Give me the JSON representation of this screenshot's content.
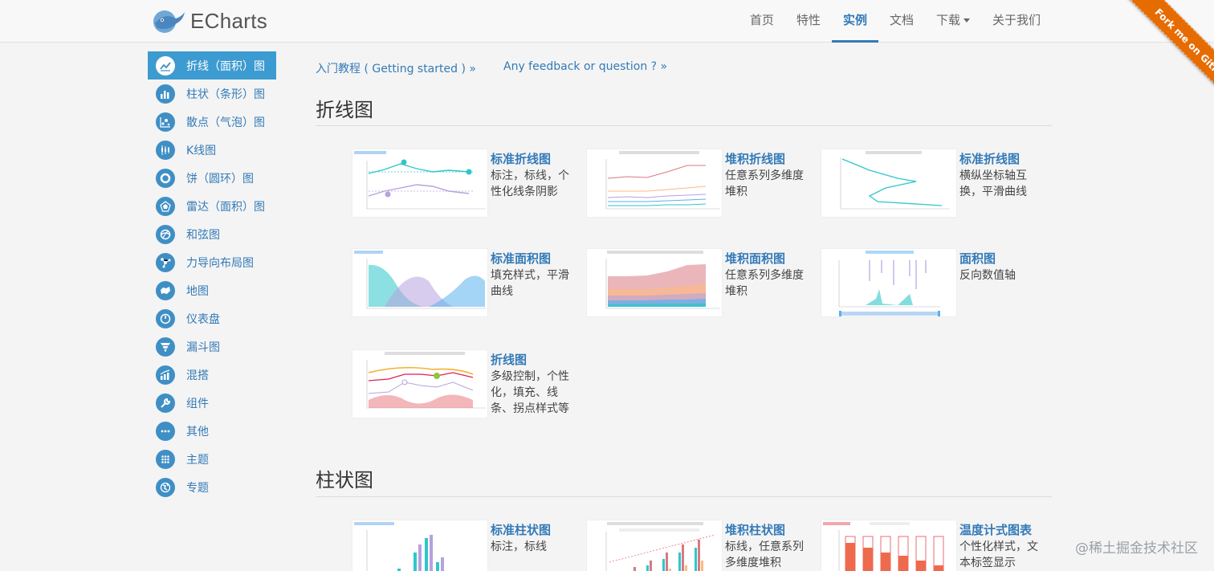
{
  "header": {
    "brand": "ECharts",
    "nav": [
      {
        "label": "首页"
      },
      {
        "label": "特性"
      },
      {
        "label": "实例"
      },
      {
        "label": "文档"
      },
      {
        "label": "下载"
      },
      {
        "label": "关于我们"
      }
    ],
    "active_nav": "实例",
    "ribbon": "Fork me on GitHub"
  },
  "sidebar": {
    "items": [
      {
        "label": "折线（面积）图",
        "icon": "line-chart-icon"
      },
      {
        "label": "柱状（条形）图",
        "icon": "bar-chart-icon"
      },
      {
        "label": "散点（气泡）图",
        "icon": "scatter-chart-icon"
      },
      {
        "label": "K线图",
        "icon": "candlestick-icon"
      },
      {
        "label": "饼（圆环）图",
        "icon": "pie-chart-icon"
      },
      {
        "label": "雷达（面积）图",
        "icon": "radar-chart-icon"
      },
      {
        "label": "和弦图",
        "icon": "chord-icon"
      },
      {
        "label": "力导向布局图",
        "icon": "force-layout-icon"
      },
      {
        "label": "地图",
        "icon": "map-icon"
      },
      {
        "label": "仪表盘",
        "icon": "gauge-icon"
      },
      {
        "label": "漏斗图",
        "icon": "funnel-icon"
      },
      {
        "label": "混搭",
        "icon": "mix-chart-icon"
      },
      {
        "label": "组件",
        "icon": "wrench-icon"
      },
      {
        "label": "其他",
        "icon": "more-icon"
      },
      {
        "label": "主题",
        "icon": "grid-dots-icon"
      },
      {
        "label": "专题",
        "icon": "globe-icon"
      }
    ]
  },
  "main": {
    "links": {
      "getting_started": "入门教程 ( Getting started ) »",
      "feedback": "Any feedback or question ? »"
    },
    "sections": [
      {
        "title": "折线图",
        "cards": [
          {
            "title": "标准折线图",
            "desc": "标注，标线，个性化线条阴影"
          },
          {
            "title": "堆积折线图",
            "desc": "任意系列多维度堆积"
          },
          {
            "title": "标准折线图",
            "desc": "横纵坐标轴互换，平滑曲线"
          },
          {
            "title": "标准面积图",
            "desc": "填充样式，平滑曲线"
          },
          {
            "title": "堆积面积图",
            "desc": "任意系列多维度堆积"
          },
          {
            "title": "面积图",
            "desc": "反向数值轴"
          },
          {
            "title": "折线图",
            "desc": "多级控制，个性化，填充、线条、拐点样式等"
          }
        ]
      },
      {
        "title": "柱状图",
        "cards": [
          {
            "title": "标准柱状图",
            "desc": "标注，标线"
          },
          {
            "title": "堆积柱状图",
            "desc": "标线，任意系列多维度堆积"
          },
          {
            "title": "温度计式图表",
            "desc": "个性化样式，文本标签显示"
          }
        ]
      }
    ]
  },
  "watermark": "@稀土掘金技术社区",
  "colors": {
    "link": "#337ab7",
    "sidebar_active": "#3c9bd0",
    "ribbon": "#e66b00"
  }
}
